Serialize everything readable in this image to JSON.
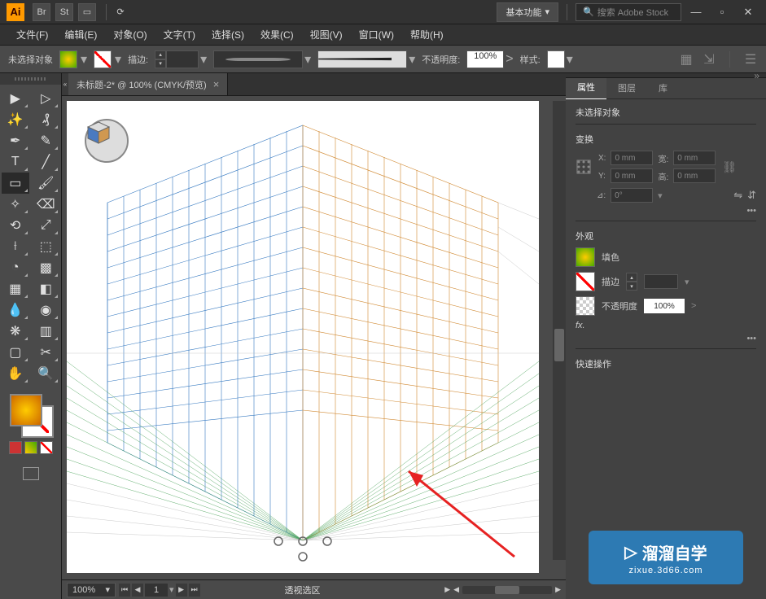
{
  "titlebar": {
    "app": "Ai",
    "icons": [
      "Br",
      "St"
    ],
    "workspace": "基本功能",
    "search_placeholder": "搜索 Adobe Stock"
  },
  "menu": [
    "文件(F)",
    "编辑(E)",
    "对象(O)",
    "文字(T)",
    "选择(S)",
    "效果(C)",
    "视图(V)",
    "窗口(W)",
    "帮助(H)"
  ],
  "controlbar": {
    "selection": "未选择对象",
    "stroke_label": "描边:",
    "stroke_value": "",
    "opacity_label": "不透明度:",
    "opacity_value": "100%",
    "style_label": "样式:"
  },
  "document": {
    "tab_title": "未标题-2* @ 100% (CMYK/预览)",
    "zoom": "100%",
    "page": "1",
    "status": "透视选区"
  },
  "props": {
    "tabs": [
      "属性",
      "图层",
      "库"
    ],
    "selection": "未选择对象",
    "transform_title": "变换",
    "fields": {
      "x_label": "X:",
      "x_val": "0 mm",
      "y_label": "Y:",
      "y_val": "0 mm",
      "w_label": "宽:",
      "w_val": "0 mm",
      "h_label": "高:",
      "h_val": "0 mm",
      "angle_label": "⊿:",
      "angle_val": "0°"
    },
    "appearance_title": "外观",
    "fill_label": "填色",
    "stroke_label": "描边",
    "opacity_label": "不透明度",
    "opacity_val": "100%",
    "effects_label": "fx.",
    "quick_title": "快速操作"
  },
  "watermark": {
    "main": "溜溜自学",
    "sub": "zixue.3d66.com"
  }
}
